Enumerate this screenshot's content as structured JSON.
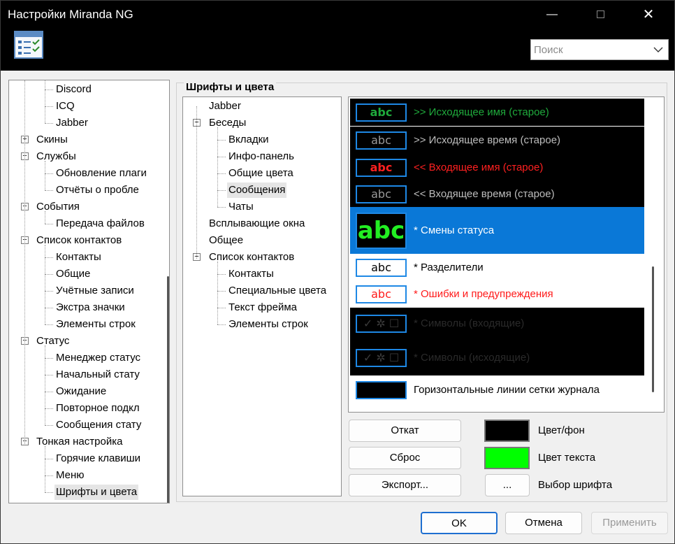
{
  "window": {
    "title": "Настройки Miranda NG",
    "minimize_icon": "minimize-icon",
    "maximize_icon": "maximize-icon",
    "close_icon": "close-icon"
  },
  "header": {
    "search": {
      "value": "Поиск"
    }
  },
  "left_tree": {
    "items": [
      {
        "label": "Discord",
        "level": 2
      },
      {
        "label": "ICQ",
        "level": 2
      },
      {
        "label": "Jabber",
        "level": 2
      },
      {
        "label": "Скины",
        "level": 1,
        "expand": "+"
      },
      {
        "label": "Службы",
        "level": 1,
        "expand": "−"
      },
      {
        "label": "Обновление плаги",
        "level": 2
      },
      {
        "label": "Отчёты о пробле",
        "level": 2
      },
      {
        "label": "События",
        "level": 1,
        "expand": "−"
      },
      {
        "label": "Передача файлов",
        "level": 2
      },
      {
        "label": "Список контактов",
        "level": 1,
        "expand": "−"
      },
      {
        "label": "Контакты",
        "level": 2
      },
      {
        "label": "Общие",
        "level": 2
      },
      {
        "label": "Учётные записи",
        "level": 2
      },
      {
        "label": "Экстра значки",
        "level": 2
      },
      {
        "label": "Элементы строк",
        "level": 2
      },
      {
        "label": "Статус",
        "level": 1,
        "expand": "−"
      },
      {
        "label": "Менеджер статус",
        "level": 2
      },
      {
        "label": "Начальный стату",
        "level": 2
      },
      {
        "label": "Ожидание",
        "level": 2
      },
      {
        "label": "Повторное подкл",
        "level": 2
      },
      {
        "label": "Сообщения стату",
        "level": 2
      },
      {
        "label": "Тонкая настройка",
        "level": 1,
        "expand": "−"
      },
      {
        "label": "Горячие клавиши",
        "level": 2
      },
      {
        "label": "Меню",
        "level": 2
      },
      {
        "label": "Шрифты и цвета",
        "level": 2,
        "selected": true
      }
    ]
  },
  "group": {
    "title": "Шрифты и цвета"
  },
  "mid_tree": {
    "items": [
      {
        "label": "Jabber",
        "level": 1
      },
      {
        "label": "Беседы",
        "level": 1,
        "expand": "−"
      },
      {
        "label": "Вкладки",
        "level": 2
      },
      {
        "label": "Инфо-панель",
        "level": 2
      },
      {
        "label": "Общие цвета",
        "level": 2
      },
      {
        "label": "Сообщения",
        "level": 2,
        "selected": true
      },
      {
        "label": "Чаты",
        "level": 2
      },
      {
        "label": "Всплывающие окна",
        "level": 1
      },
      {
        "label": "Общее",
        "level": 1
      },
      {
        "label": "Список контактов",
        "level": 1,
        "expand": "−"
      },
      {
        "label": "Контакты",
        "level": 2
      },
      {
        "label": "Специальные цвета",
        "level": 2
      },
      {
        "label": "Текст фрейма",
        "level": 2
      },
      {
        "label": "Элементы строк",
        "level": 2
      }
    ]
  },
  "font_list": {
    "items": [
      {
        "sample": "abc",
        "label": ">> Исходящее имя (старое)",
        "bg": "#000000",
        "fg": "#1faa3c",
        "sample_bg": "#000000",
        "sample_fg": "#1faa3c",
        "sample_bold": true
      },
      {
        "sample": "abc",
        "label": ">> Исходящее время (старое)",
        "bg": "#000000",
        "fg": "#bdbdbd",
        "sample_bg": "#000000",
        "sample_fg": "#9a9a9a"
      },
      {
        "sample": "abc",
        "label": "<< Входящее имя (старое)",
        "bg": "#000000",
        "fg": "#ff2020",
        "sample_bg": "#000000",
        "sample_fg": "#ff2020",
        "sample_bold": true
      },
      {
        "sample": "abc",
        "label": "<< Входящее время (старое)",
        "bg": "#000000",
        "fg": "#bdbdbd",
        "sample_bg": "#000000",
        "sample_fg": "#9a9a9a"
      },
      {
        "sample": "abc",
        "label": "* Смены статуса",
        "bg": "#0a78d7",
        "fg": "#ffffff",
        "sample_bg": "#000000",
        "sample_fg": "#22ee22",
        "sample_bold": true,
        "big": true,
        "selected": true
      },
      {
        "sample": "abc",
        "label": "* Разделители",
        "bg": "#ffffff",
        "fg": "#000000",
        "sample_bg": "#ffffff",
        "sample_fg": "#000000"
      },
      {
        "sample": "abc",
        "label": "* Ошибки и предупреждения",
        "bg": "#ffffff",
        "fg": "#ff1a1a",
        "sample_bg": "#ffffff",
        "sample_fg": "#ff1a1a"
      },
      {
        "sample": "✓ ✲ ☐",
        "label": "* Символы (входящие)",
        "bg": "#000000",
        "fg": "#2a2a2a",
        "sample_bg": "#000000",
        "sample_fg": "#3a3a3a"
      },
      {
        "sample": "✓ ✲ ☐",
        "label": "* Символы (исходящие)",
        "bg": "#000000",
        "fg": "#2a2a2a",
        "sample_bg": "#000000",
        "sample_fg": "#3a3a3a"
      },
      {
        "sample": "",
        "label": "Горизонтальные линии сетки журнала",
        "bg": "#ffffff",
        "fg": "#000000",
        "sample_bg": "#000000",
        "sample_fg": "#000000"
      }
    ]
  },
  "buttons": {
    "revert": "Откат",
    "reset": "Сброс",
    "export": "Экспорт...",
    "choose_font": "...",
    "ok": "OK",
    "cancel": "Отмена",
    "apply": "Применить"
  },
  "color_options": {
    "background": {
      "label": "Цвет/фон",
      "color": "#000000"
    },
    "text": {
      "label": "Цвет текста",
      "color": "#00ff00"
    },
    "font": {
      "label": "Выбор шрифта"
    }
  }
}
